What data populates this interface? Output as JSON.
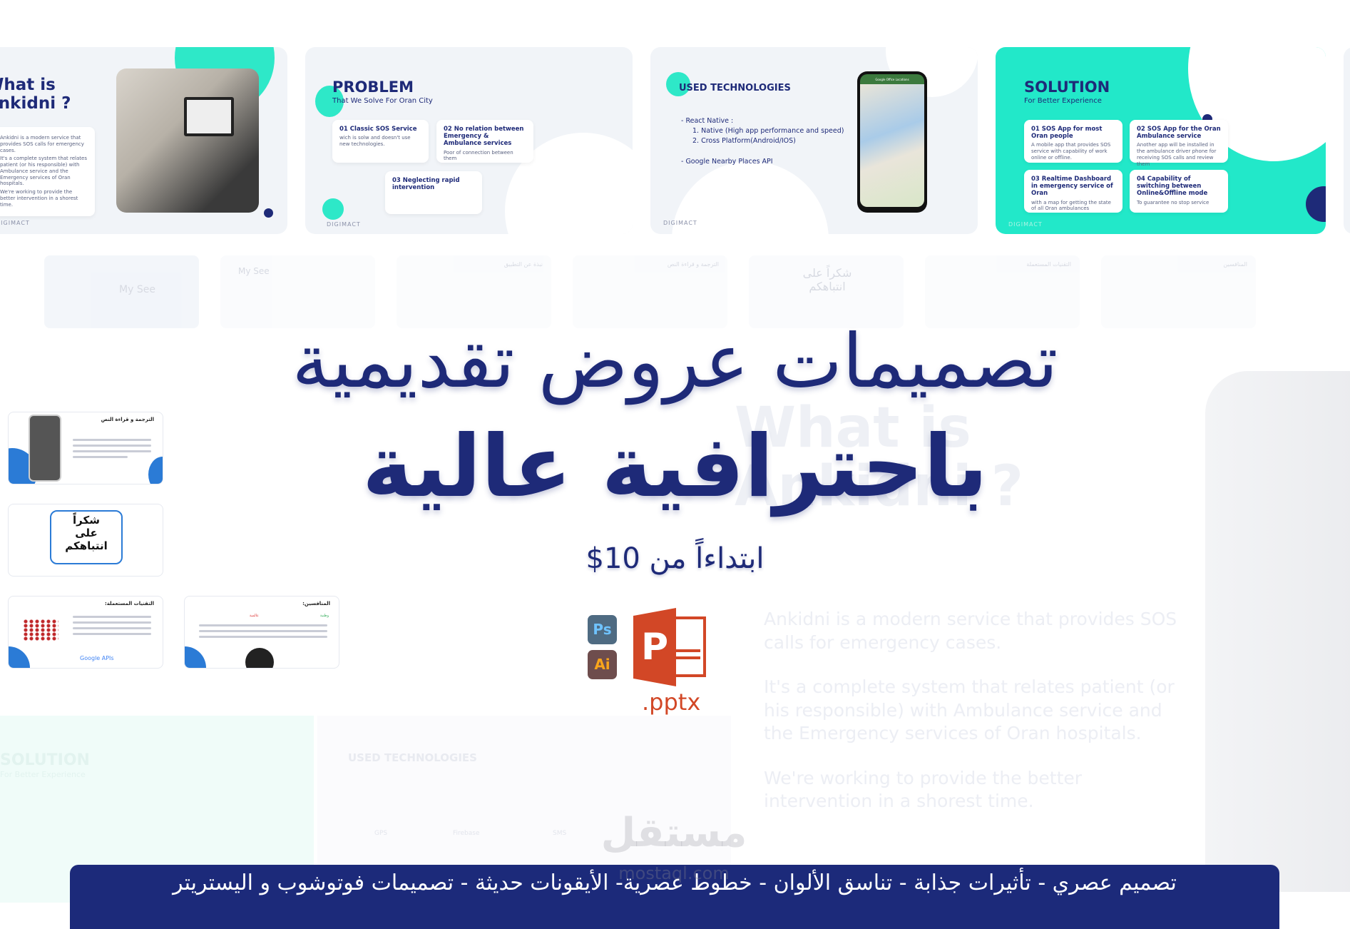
{
  "slides_top": {
    "what_is": {
      "title_1": "What is",
      "title_2": "Ankidni ?",
      "p1": "Ankidni is a modern service that provides SOS calls for emergency cases.",
      "p2": "It's a complete system that relates patient (or his responsible) with Ambulance service and the Emergency services of Oran hospitals.",
      "p3": "We're working to provide the better intervention in a shorest time."
    },
    "problem": {
      "title": "PROBLEM",
      "subtitle": "That We Solve For Oran City",
      "cards": [
        {
          "title": "01 Classic SOS Service",
          "text": "wich is solw and doesn't use new technologies."
        },
        {
          "title": "02 No relation between Emergency & Ambulance services",
          "text": "Poor of connection between them"
        },
        {
          "title": "03 Neglecting rapid intervention",
          "text": ""
        }
      ]
    },
    "tech": {
      "title": "USED TECHNOLOGIES",
      "item1": "- React Native :",
      "sub1": "1.   Native (High app performance and speed)",
      "sub2": "2.   Cross Platform(Android/IOS)",
      "item2": "- Google Nearby Places API",
      "phone_header": "Google Office Locations"
    },
    "solution": {
      "title": "SOLUTION",
      "subtitle": "For Better Experience",
      "cards": [
        {
          "title": "01 SOS App for most Oran people",
          "text": "A mobile app that provides SOS service with capability of work online or offline."
        },
        {
          "title": "02 SOS App for the Oran Ambulance service",
          "text": "Another app will be installed in the ambulance driver phone for receiving SOS calls and review them"
        },
        {
          "title": "03  Realtime Dashboard in emergency service of Oran",
          "text": "with a map for getting the state of all Oran ambulances"
        },
        {
          "title": "04 Capability of switching between Online&Offline mode",
          "text": "To guarantee no stop service"
        }
      ]
    },
    "footer_brand": "DIGIMACT"
  },
  "thumbs_faded": [
    "My See",
    "My See",
    "نبذة عن التطبيق",
    "الترجمة و قراءة النص",
    "شكراً على انتباهكم",
    "التقنيات المستعملة",
    "المنافسين"
  ],
  "left_thumbs": {
    "translate_title": "الترجمة و قراءة النص",
    "thanks": [
      "شكراً",
      "على",
      "انتباهكم"
    ],
    "techs_title": "التقنيات المستعملة:",
    "techs_logo": "Google APIs",
    "competitors_title": "المنافسين:",
    "competitors_local": "وطنية",
    "competitors_global": "عالمية"
  },
  "hero": {
    "line1": "تصميمات عروض تقديمية",
    "line2": "باحترافية عالية",
    "price": "ابتداءاً من 10$"
  },
  "icons": {
    "ps": "Ps",
    "ai": "Ai",
    "ppt_letter": "P",
    "format": ".pptx",
    "ppt_color": "#d24726",
    "ps_color": "#4f6b82",
    "ai_color": "#6e4d4d"
  },
  "background": {
    "what_is": "What is Ankidni ?",
    "p1": "Ankidni is a modern service that provides SOS calls for emergency cases.",
    "p2": "It's a complete system that relates patient (or his responsible) with Ambulance service and the Emergency services of Oran hospitals.",
    "p3": "We're working to provide the better intervention in a shorest time.",
    "solution": "SOLUTION",
    "solution_sub": "For Better Experience",
    "tech": "USED TECHNOLOGIES",
    "tech_items": [
      "GPS",
      "Firebase",
      "SMS"
    ]
  },
  "watermark": {
    "ar": "مستقل",
    "en": "mostaql.com"
  },
  "banner": {
    "text": "تصميم عصري - تأثيرات جذابة - تناسق الألوان - خطوط عصرية- الأيقونات حديثة - تصميمات فوتوشوب و اليستريتر",
    "color": "#1c2a7a"
  },
  "colors": {
    "navy": "#1e2a78",
    "teal": "#2ee8c8"
  }
}
